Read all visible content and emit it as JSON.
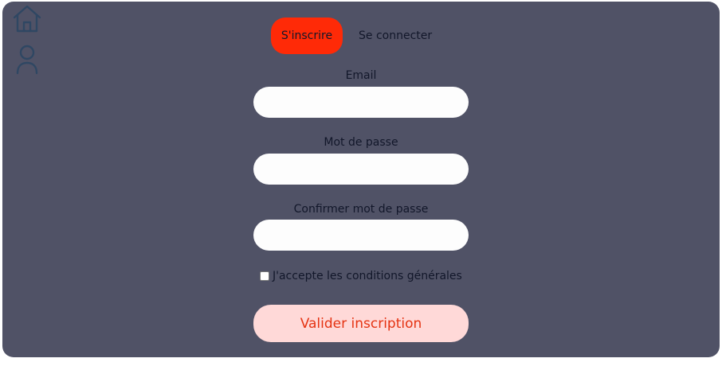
{
  "colors": {
    "panel": "#505266",
    "accent": "#ff2a07",
    "submit_bg": "#ffd9d8",
    "submit_text": "#e53312",
    "icon": "#2f4763"
  },
  "sidebar": {
    "icons": [
      "home-icon",
      "user-icon"
    ]
  },
  "tabs": {
    "signup": "S'inscrire",
    "login": "Se connecter"
  },
  "form": {
    "email_label": "Email",
    "email_value": "",
    "password_label": "Mot de passe",
    "password_value": "",
    "confirm_label": "Confirmer mot de passe",
    "confirm_value": "",
    "terms_label": "J'accepte les conditions générales",
    "terms_checked": false,
    "submit_label": "Valider inscription"
  }
}
